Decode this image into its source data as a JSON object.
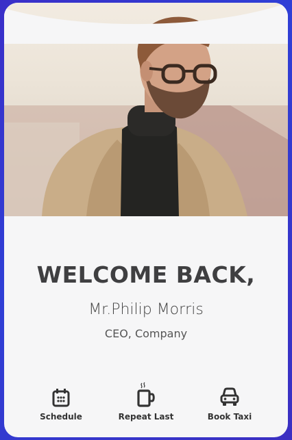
{
  "profile": {
    "greeting": "WELCOME BACK,",
    "name": "Mr.Philip Morris",
    "role": "CEO, Company"
  },
  "actions": [
    {
      "label": "Schedule",
      "icon": "calendar-icon"
    },
    {
      "label": "Repeat Last",
      "icon": "coffee-cup-icon"
    },
    {
      "label": "Book Taxi",
      "icon": "car-icon"
    }
  ],
  "colors": {
    "background": "#3a2fc8",
    "card": "#f6f6f7",
    "text_dark": "#3f3f41",
    "icon": "#333333"
  }
}
